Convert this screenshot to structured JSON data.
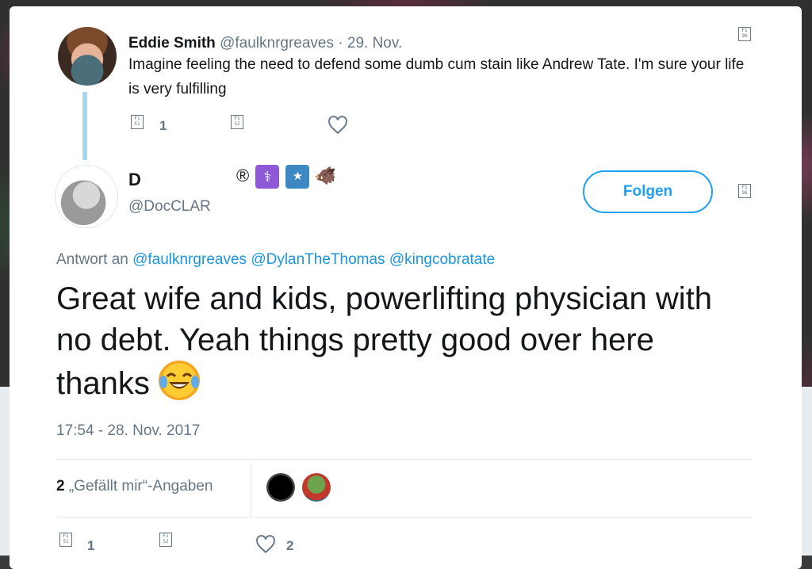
{
  "parent_tweet": {
    "name": "Eddie Smith",
    "handle": "@faulknrgreaves",
    "date": "· 29. Nov.",
    "text": "Imagine feeling the need to defend some dumb cum stain like Andrew Tate. I'm sure your life is very fulfilling",
    "reply_count": "1",
    "caret_icon": "F1\n96",
    "reply_icon": "F1\n51",
    "retweet_icon": "F1\n52"
  },
  "main_tweet": {
    "name": "D",
    "badges": [
      "®",
      "⚕",
      "★",
      "🐗"
    ],
    "handle": "@DocCLAR",
    "follow_label": "Folgen",
    "reply_prefix": "Antwort an",
    "mentions": [
      "@faulknrgreaves",
      "@DylanTheThomas",
      "@kingcobratate"
    ],
    "text": "Great wife and kids, powerlifting physician with no debt. Yeah things pretty good over here thanks",
    "timestamp": "17:54 - 28. Nov. 2017",
    "likes_count": "2",
    "likes_label": "„Gefällt mir“-Angaben",
    "reply_count": "1",
    "like_count": "2"
  },
  "icons": {
    "caret": "caret-icon",
    "reply": "reply-icon",
    "retweet": "retweet-icon",
    "like": "heart-icon",
    "emoji": "face-with-tears-of-joy"
  },
  "colors": {
    "accent": "#1da1f2",
    "link": "#1b95e0",
    "muted": "#657786",
    "thread_line": "#a8d6e8",
    "badge_purple": "#8e59d6",
    "badge_blue": "#3b88c3"
  }
}
